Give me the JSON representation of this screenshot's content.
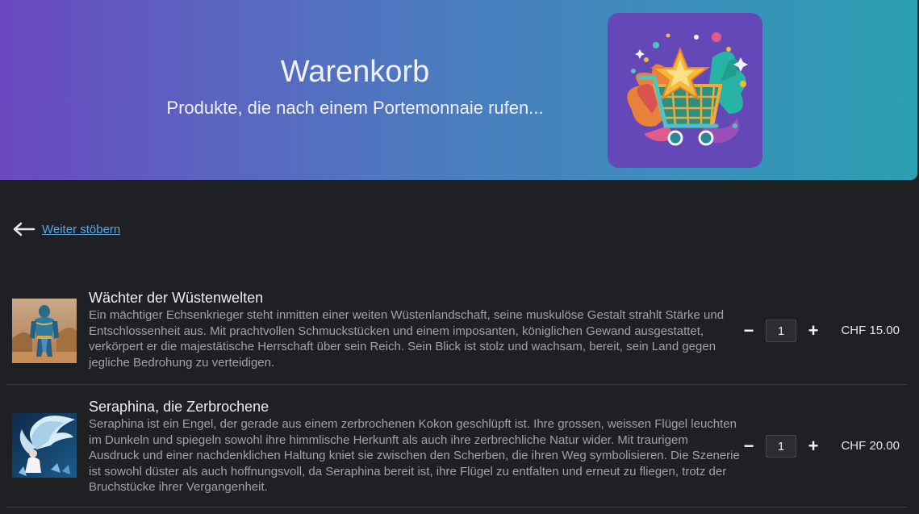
{
  "header": {
    "title": "Warenkorb",
    "subtitle": "Produkte, die nach einem Portemonnaie rufen...",
    "logo_icon": "shopping-cart-star-logo",
    "gradient_start": "#6a48bf",
    "gradient_end": "#2aa0b0"
  },
  "back_link": {
    "label": "Weiter stöbern",
    "icon": "arrow-left-icon",
    "color": "#58a8e6"
  },
  "cart": {
    "items": [
      {
        "title": "Wächter der Wüstenwelten",
        "description": "Ein mächtiger Echsenkrieger steht inmitten einer weiten Wüstenlandschaft, seine muskulöse Gestalt strahlt Stärke und Entschlossenheit aus. Mit prachtvollen Schmuckstücken und einem imposanten, königlichen Gewand ausgestattet, verkörpert er die majestätische Herrschaft über sein Reich. Sein Blick ist stolz und wachsam, bereit, sein Land gegen jegliche Bedrohung zu verteidigen.",
        "quantity": "1",
        "price": "CHF 15.00",
        "decrease_label": "−",
        "increase_label": "+"
      },
      {
        "title": "Seraphina, die Zerbrochene",
        "description": "Seraphina ist ein Engel, der gerade aus einem zerbrochenen Kokon geschlüpft ist. Ihre grossen, weissen Flügel leuchten im Dunkeln und spiegeln sowohl ihre himmlische Herkunft als auch ihre zerbrechliche Natur wider. Mit traurigem Ausdruck und einer nachdenklichen Haltung kniet sie zwischen den Scherben, die ihren Weg symbolisieren. Die Szenerie ist sowohl düster als auch hoffnungsvoll, da Seraphina bereit ist, ihre Flügel zu entfalten und erneut zu fliegen, trotz der Bruchstücke ihrer Vergangenheit.",
        "quantity": "1",
        "price": "CHF 20.00",
        "decrease_label": "−",
        "increase_label": "+"
      }
    ]
  }
}
